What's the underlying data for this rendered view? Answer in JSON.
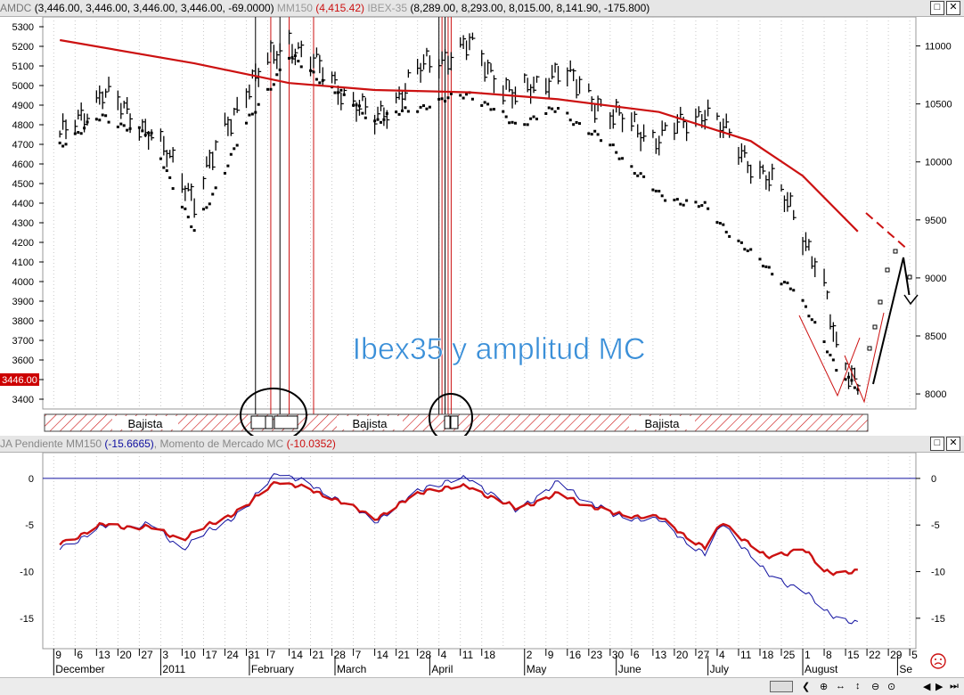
{
  "top_panel": {
    "header": {
      "symbol": "AMDC",
      "symbol_values": "(3,446.00, 3,446.00, 3,446.00, 3,446.00, -69.0000)",
      "ma_name": "MM150",
      "ma_value": "(4,415.42)",
      "index_name": "IBEX-35",
      "index_values": "(8,289.00, 8,293.00, 8,015.00, 8,141.90, -175.800)"
    },
    "current_value_label": "3446.00",
    "title_text": "Ibex35 y amplitud MC",
    "regime_labels": [
      "Bajista",
      "Bajista",
      "Bajista"
    ],
    "colors": {
      "ma_line": "#cc1111",
      "title": "#3a8fd8",
      "bars": "#000000",
      "highlight_lines": "#cc1111"
    }
  },
  "bottom_panel": {
    "header": {
      "series1_name": "JA Pendiente MM150",
      "series1_value": "(-15.6665)",
      "series2_name": "Momento de Mercado MC",
      "series2_value": "(-10.0352)"
    },
    "colors": {
      "series1": "#1010a0",
      "series2": "#cc1111"
    }
  },
  "x_axis": {
    "day_labels": [
      "9",
      "6",
      "13",
      "20",
      "27",
      "3",
      "10",
      "17",
      "24",
      "31",
      "7",
      "14",
      "21",
      "28",
      "7",
      "14",
      "21",
      "28",
      "4",
      "11",
      "18",
      "2",
      "9",
      "16",
      "23",
      "30",
      "6",
      "13",
      "20",
      "27",
      "4",
      "11",
      "18",
      "25",
      "1",
      "8",
      "15",
      "22",
      "29",
      "5"
    ],
    "month_labels": [
      "December",
      "2011",
      "February",
      "March",
      "April",
      "May",
      "June",
      "July",
      "August",
      "Se"
    ]
  },
  "buttons": {
    "maximize": "□",
    "close": "✕"
  },
  "chart_data": [
    {
      "type": "bar",
      "title": "Ibex35 y amplitud MC",
      "left_axis_ticks": [
        5300,
        5200,
        5100,
        5000,
        4900,
        4800,
        4700,
        4600,
        4500,
        4400,
        4300,
        4200,
        4100,
        4000,
        3900,
        3800,
        3700,
        3600,
        3500,
        3400
      ],
      "right_axis_ticks": [
        11000,
        10500,
        10000,
        9500,
        9000,
        8500,
        8000
      ],
      "ylim_left": [
        3350,
        5350
      ],
      "ylim_right": [
        7870,
        11250
      ],
      "series": [
        {
          "name": "IBEX-35",
          "axis": "right",
          "style": "hlc_bars",
          "x": [
            "2010-12-01",
            "2010-12-15",
            "2010-12-31",
            "2011-01-14",
            "2011-01-31",
            "2011-02-14",
            "2011-02-28",
            "2011-03-14",
            "2011-03-31",
            "2011-04-14",
            "2011-04-29",
            "2011-05-13",
            "2011-05-31",
            "2011-06-15",
            "2011-06-30",
            "2011-07-15",
            "2011-07-29",
            "2011-08-08",
            "2011-08-12",
            "2011-08-19"
          ],
          "y": [
            10200,
            10600,
            10250,
            9700,
            10650,
            11050,
            10700,
            10350,
            10850,
            11000,
            10550,
            10800,
            10400,
            10200,
            10450,
            10000,
            9600,
            8900,
            8400,
            8100
          ]
        },
        {
          "name": "AMDC",
          "axis": "left",
          "style": "dots",
          "x": [
            "2010-12-01",
            "2010-12-15",
            "2010-12-31",
            "2011-01-14",
            "2011-01-31",
            "2011-02-14",
            "2011-02-28",
            "2011-03-14",
            "2011-03-31",
            "2011-04-14",
            "2011-04-29",
            "2011-05-13",
            "2011-05-31",
            "2011-06-15",
            "2011-06-30",
            "2011-07-15",
            "2011-07-29",
            "2011-08-08",
            "2011-08-12",
            "2011-08-19"
          ],
          "y": [
            4700,
            4840,
            4740,
            4250,
            4800,
            5150,
            4990,
            4820,
            4900,
            4960,
            4800,
            4880,
            4680,
            4440,
            4380,
            4140,
            3960,
            3700,
            3560,
            3446
          ]
        },
        {
          "name": "MM150",
          "axis": "right",
          "style": "line",
          "x": [
            "2010-12-01",
            "2011-01-14",
            "2011-02-14",
            "2011-03-14",
            "2011-04-14",
            "2011-05-13",
            "2011-06-15",
            "2011-07-15",
            "2011-08-01",
            "2011-08-19"
          ],
          "y": [
            11050,
            10850,
            10680,
            10620,
            10600,
            10540,
            10430,
            10180,
            9880,
            9400
          ]
        }
      ]
    },
    {
      "type": "line",
      "ylim": [
        -17.5,
        2
      ],
      "y_ticks": [
        0,
        -5,
        -10,
        -15
      ],
      "series": [
        {
          "name": "JA Pendiente MM150",
          "x": [
            "2010-12-01",
            "2010-12-15",
            "2010-12-31",
            "2011-01-10",
            "2011-01-31",
            "2011-02-10",
            "2011-02-28",
            "2011-03-14",
            "2011-03-31",
            "2011-04-14",
            "2011-04-29",
            "2011-05-13",
            "2011-05-31",
            "2011-06-15",
            "2011-06-30",
            "2011-07-06",
            "2011-07-20",
            "2011-08-01",
            "2011-08-08",
            "2011-08-19"
          ],
          "y": [
            -7.5,
            -5.2,
            -5.0,
            -7.5,
            -3.2,
            0.8,
            -1.8,
            -4.6,
            -0.8,
            0.0,
            -3.4,
            -0.5,
            -4.0,
            -4.5,
            -8.2,
            -4.8,
            -10.2,
            -12.0,
            -14.2,
            -15.6665
          ]
        },
        {
          "name": "Momento de Mercado MC",
          "x": [
            "2010-12-01",
            "2010-12-15",
            "2010-12-31",
            "2011-01-10",
            "2011-01-31",
            "2011-02-10",
            "2011-02-28",
            "2011-03-14",
            "2011-03-31",
            "2011-04-14",
            "2011-04-29",
            "2011-05-13",
            "2011-05-31",
            "2011-06-15",
            "2011-06-30",
            "2011-07-06",
            "2011-07-20",
            "2011-08-01",
            "2011-08-08",
            "2011-08-19"
          ],
          "y": [
            -7.0,
            -5.0,
            -5.3,
            -6.5,
            -3.0,
            -0.2,
            -2.0,
            -4.3,
            -1.2,
            -0.9,
            -3.2,
            -1.7,
            -3.8,
            -4.2,
            -7.5,
            -4.7,
            -8.5,
            -7.5,
            -10.0,
            -10.0352
          ]
        }
      ]
    }
  ]
}
